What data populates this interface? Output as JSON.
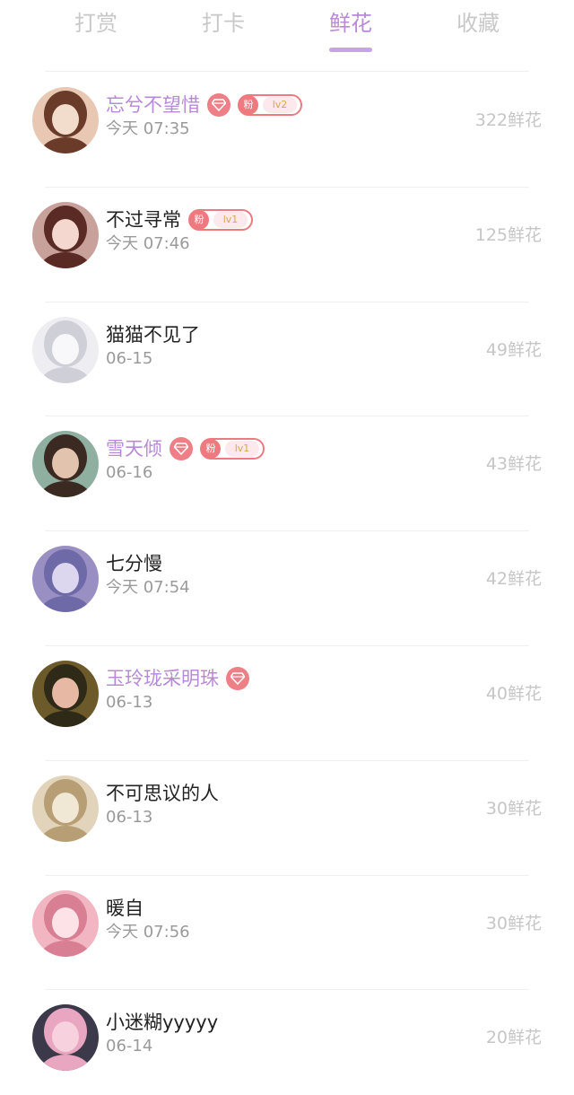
{
  "tabs": [
    {
      "label": "打赏",
      "active": false
    },
    {
      "label": "打卡",
      "active": false
    },
    {
      "label": "鲜花",
      "active": true
    },
    {
      "label": "收藏",
      "active": false
    }
  ],
  "colors": {
    "accent": "#b98ad8",
    "vip_name": "#b889d6",
    "badge": "#ee7a80",
    "muted": "#9a9a9a",
    "flower_count": "#c6c6c6"
  },
  "rows": [
    {
      "name": "忘兮不望惜",
      "vip": true,
      "fan": {
        "label": "粉",
        "level": "lv2"
      },
      "time": "今天 07:35",
      "flowers": "322鲜花"
    },
    {
      "name": "不过寻常",
      "vip": false,
      "fan": {
        "label": "粉",
        "level": "lv1"
      },
      "time": "今天 07:46",
      "flowers": "125鲜花"
    },
    {
      "name": "猫猫不见了",
      "vip": false,
      "fan": null,
      "time": "06-15",
      "flowers": "49鲜花"
    },
    {
      "name": "雪天倾",
      "vip": true,
      "fan": {
        "label": "粉",
        "level": "lv1"
      },
      "time": "06-16",
      "flowers": "43鲜花"
    },
    {
      "name": "七分慢",
      "vip": false,
      "fan": null,
      "time": "今天 07:54",
      "flowers": "42鲜花"
    },
    {
      "name": "玉玲珑采明珠",
      "vip": true,
      "fan": null,
      "time": "06-13",
      "flowers": "40鲜花"
    },
    {
      "name": "不可思议的人",
      "vip": false,
      "fan": null,
      "time": "06-13",
      "flowers": "30鲜花"
    },
    {
      "name": "暖自",
      "vip": false,
      "fan": null,
      "time": "今天 07:56",
      "flowers": "30鲜花"
    },
    {
      "name": "小迷糊yyyyy",
      "vip": false,
      "fan": null,
      "time": "06-14",
      "flowers": "20鲜花"
    }
  ]
}
